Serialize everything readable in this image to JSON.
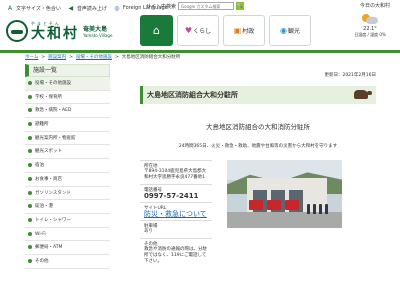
{
  "utility": {
    "text_size": "文字サイズ・色合い",
    "read_aloud": "音声読み上げ",
    "foreign": "Foreign Language",
    "search_label": "サイト内検索",
    "search_placeholder": "Google カスタム検索",
    "search_button": "🔍"
  },
  "header": {
    "logo_ruby": "やまとそん",
    "logo_main": "大和村",
    "logo_sub_top": "奄美大島",
    "logo_sub_bottom": "Yamato Village",
    "date": "今日の大和村"
  },
  "gnav": {
    "home": "⌂",
    "kurashi": "くらし",
    "sonsei": "村政",
    "kanko": "観光"
  },
  "weather": {
    "temp": "22.1°",
    "rain": "日湿度 / 湿度 0%"
  },
  "breadcrumb": {
    "home": "ホーム",
    "sep1": ">",
    "facilities": "施設案内",
    "sep2": ">",
    "category": "役場・その他施設",
    "sep3": ">",
    "current": "大島地区消防組合大和分駐所"
  },
  "sidebar": {
    "title": "施設一覧",
    "items": [
      "役場・その他施設",
      "学校・保育所",
      "救急・病院・AED",
      "避難所",
      "観光案内所・物産館",
      "観光スポット",
      "宿泊",
      "お食事・商店",
      "ガソリンスタンド",
      "碇泊・港",
      "トイレ・シャワー",
      "Wi-Fi",
      "郵便局・ATM",
      "その他"
    ]
  },
  "main": {
    "updated": "更新日：2021年2月16日",
    "heading": "大島地区消防組合大和分駐所",
    "lead_title": "大島地区消防組合の大和消防分駐所",
    "lead_text": "24時間365日、火災・救急・救助、地震や台風等の災害から大和村を守ります",
    "address_label": "所在地",
    "address_value": "〒894-3104鹿児島県大島郡大和村大字思勝字永良477番地1",
    "phone_label": "電話番号",
    "phone_value": "0997-57-2411",
    "site_label": "サイトURL",
    "site_value": "防災・救急について",
    "parking_label": "駐車場",
    "parking_value": "あり",
    "other_label": "その他",
    "other_value": "救急や消防の通報の際は、分駐所ではなく、119にご電話して下さい。"
  }
}
